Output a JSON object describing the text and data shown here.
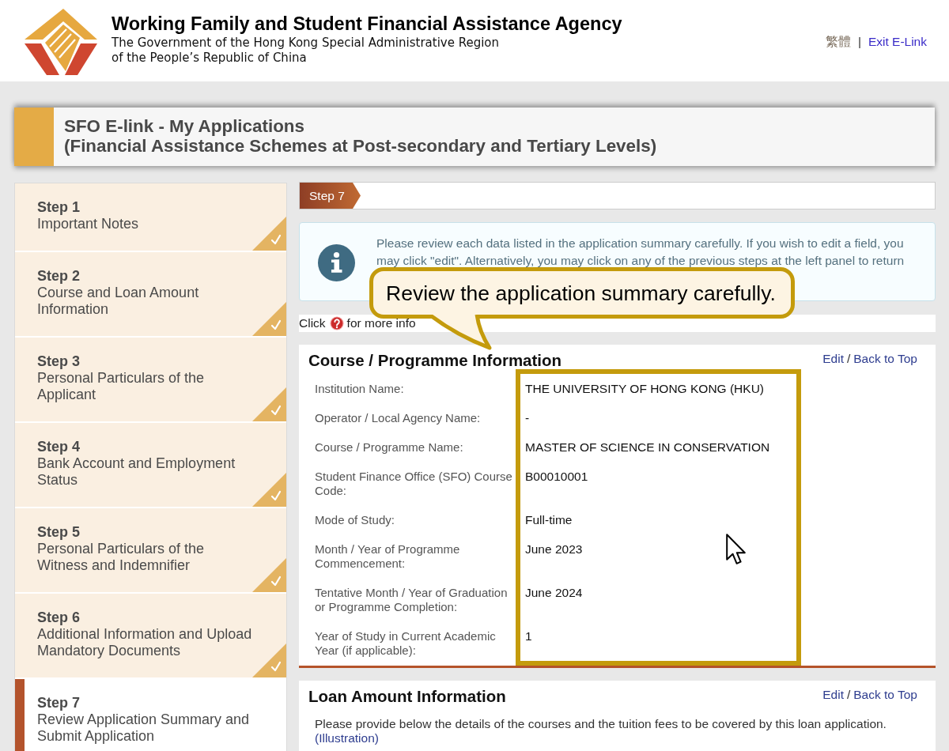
{
  "header": {
    "agency_name": "Working Family and Student Financial Assistance Agency",
    "government_lines": [
      "The Government of the Hong Kong Special Administrative Region",
      "of the People’s Republic of China"
    ],
    "language_link": "繁體",
    "separator": "|",
    "exit_link": "Exit E-Link"
  },
  "title_bar": {
    "title": "SFO E-link - My Applications",
    "subtitle": "(Financial Assistance Schemes at Post-secondary and Tertiary Levels)"
  },
  "steps": [
    {
      "number": "Step 1",
      "label": "Important Notes",
      "completed": true,
      "selected": false
    },
    {
      "number": "Step 2",
      "label": "Course and Loan Amount\nInformation",
      "completed": true,
      "selected": false
    },
    {
      "number": "Step 3",
      "label": "Personal Particulars of the\nApplicant",
      "completed": true,
      "selected": false
    },
    {
      "number": "Step 4",
      "label": "Bank Account and Employment\nStatus",
      "completed": true,
      "selected": false
    },
    {
      "number": "Step 5",
      "label": "Personal Particulars of the\nWitness and Indemnifier",
      "completed": true,
      "selected": false
    },
    {
      "number": "Step 6",
      "label": "Additional Information and Upload\nMandatory Documents",
      "completed": true,
      "selected": false
    },
    {
      "number": "Step 7",
      "label": "Review Application Summary and\nSubmit Application",
      "completed": false,
      "selected": true
    }
  ],
  "current_step": "Step 7",
  "info_note": "Please review each data listed in the application summary carefully. If you wish to edit a field, you may click \"edit\". Alternatively, you may click on any of the previous steps at the left panel to return",
  "help_hint": {
    "before": "Click",
    "after": "for more info"
  },
  "sections": [
    {
      "kind": "fields",
      "title": "Course / Programme Information",
      "edit_link": "Edit",
      "separator": "/",
      "top_link": "Back to Top",
      "values_highlighted": true,
      "fields": [
        {
          "label": "Institution Name:",
          "value": "THE UNIVERSITY OF HONG KONG (HKU)"
        },
        {
          "label": "Operator / Local Agency Name:",
          "value": "-"
        },
        {
          "label": "Course / Programme Name:",
          "value": "MASTER OF SCIENCE IN CONSERVATION"
        },
        {
          "label": "Student Finance Office (SFO) Course\nCode:",
          "value": "B00010001"
        },
        {
          "label": "Mode of Study:",
          "value": "Full-time"
        },
        {
          "label": "Month / Year of Programme\nCommencement:",
          "value": "June 2023"
        },
        {
          "label": "Tentative Month / Year of Graduation\nor Programme Completion:",
          "value": "June 2024"
        },
        {
          "label": "Year of Study in Current Academic\nYear (if applicable):",
          "value": "1"
        }
      ]
    },
    {
      "kind": "text",
      "title": "Loan Amount Information",
      "edit_link": "Edit",
      "separator": "/",
      "top_link": "Back to Top",
      "description": "Please provide below the details of the courses and the tuition fees to be covered by this loan application.",
      "link": "(Illustration)"
    }
  ],
  "callout": {
    "text": "Review the application summary carefully."
  }
}
